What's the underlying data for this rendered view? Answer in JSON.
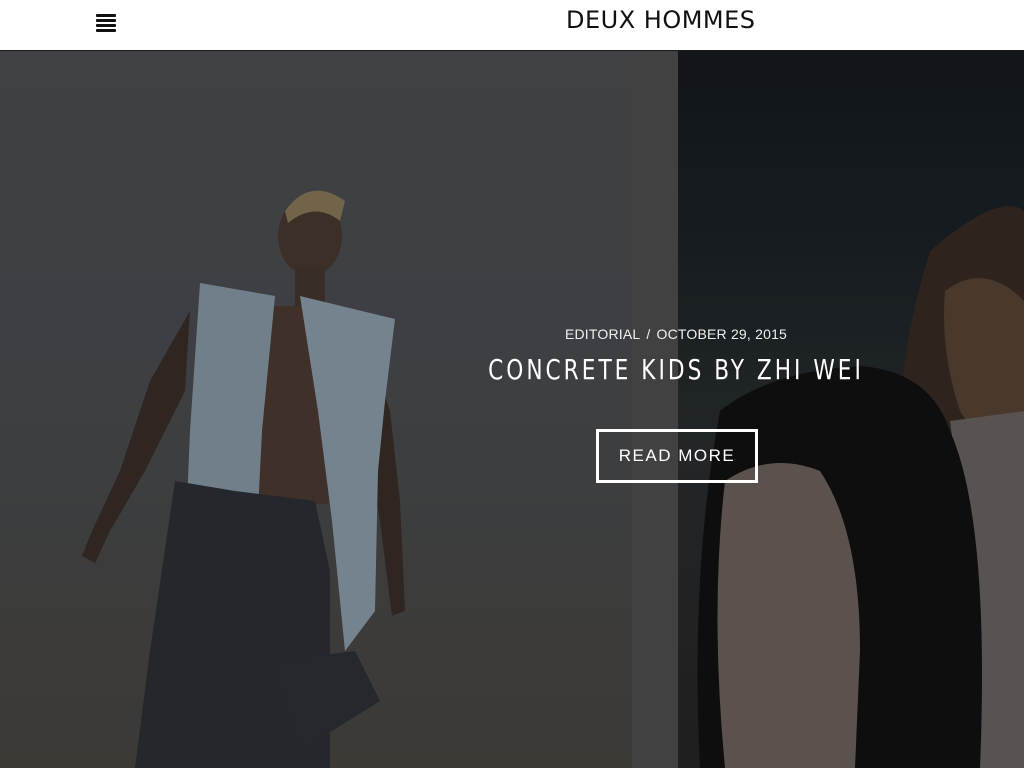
{
  "header": {
    "site_name": "DEUX HOMMES",
    "menu_icon": "hamburger-menu-icon"
  },
  "featured_post": {
    "category": "EDITORIAL",
    "separator": "/",
    "date": "OCTOBER 29, 2015",
    "title": "CONCRETE KIDS BY ZHI WEI",
    "cta_label": "READ MORE"
  },
  "colors": {
    "header_bg": "#ffffff",
    "logo_text": "#111111",
    "overlay_text": "#ffffff",
    "hero_left_sky": "#4d5055",
    "hero_right_sky": "#1b2227"
  }
}
